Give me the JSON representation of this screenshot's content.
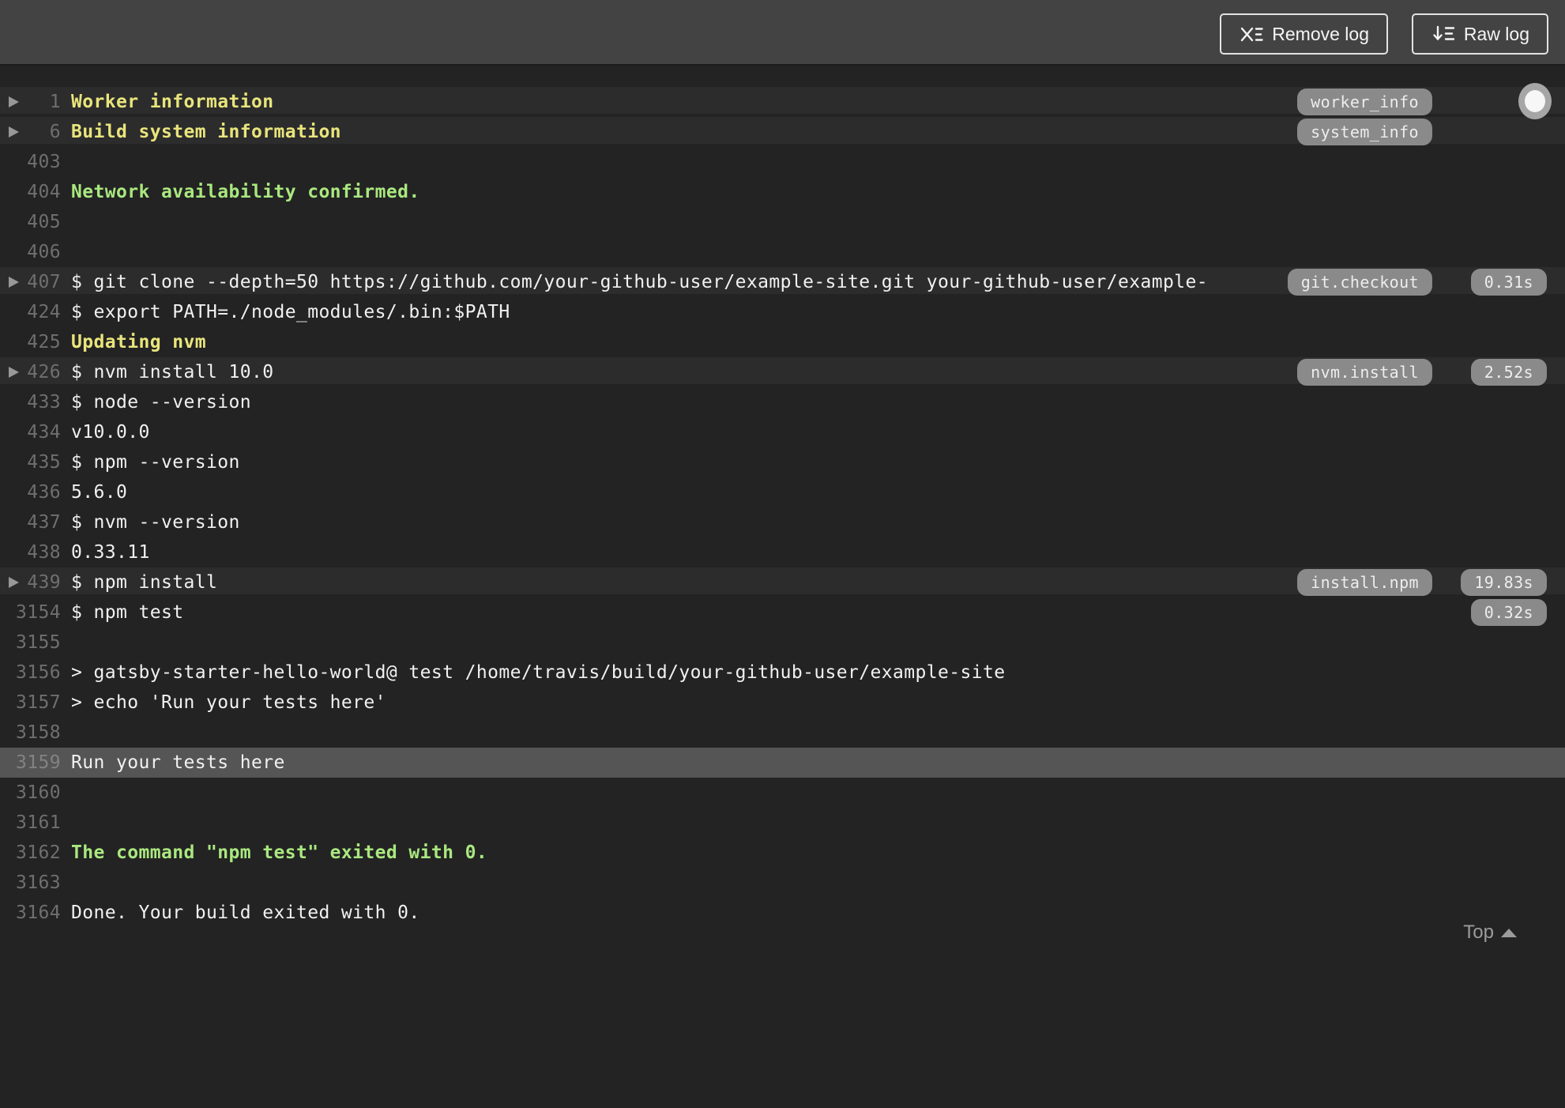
{
  "toolbar": {
    "remove_log_label": "Remove log",
    "raw_log_label": "Raw log"
  },
  "log": {
    "rows": [
      {
        "num": "1",
        "text": "Worker information",
        "style": "yellow",
        "fold": true,
        "arrow": true,
        "tag": "worker_info"
      },
      {
        "num": "6",
        "text": "Build system information",
        "style": "yellow",
        "fold": true,
        "arrow": true,
        "tag": "system_info"
      },
      {
        "num": "403",
        "text": ""
      },
      {
        "num": "404",
        "text": "Network availability confirmed.",
        "style": "green"
      },
      {
        "num": "405",
        "text": ""
      },
      {
        "num": "406",
        "text": ""
      },
      {
        "num": "407",
        "text": "$ git clone --depth=50 https://github.com/your-github-user/example-site.git your-github-user/example-",
        "fold": true,
        "arrow": true,
        "tag": "git.checkout",
        "duration": "0.31s"
      },
      {
        "num": "424",
        "text": "$ export PATH=./node_modules/.bin:$PATH"
      },
      {
        "num": "425",
        "text": "Updating nvm",
        "style": "yellow"
      },
      {
        "num": "426",
        "text": "$ nvm install 10.0",
        "fold": true,
        "arrow": true,
        "tag": "nvm.install",
        "duration": "2.52s"
      },
      {
        "num": "433",
        "text": "$ node --version"
      },
      {
        "num": "434",
        "text": "v10.0.0"
      },
      {
        "num": "435",
        "text": "$ npm --version"
      },
      {
        "num": "436",
        "text": "5.6.0"
      },
      {
        "num": "437",
        "text": "$ nvm --version"
      },
      {
        "num": "438",
        "text": "0.33.11"
      },
      {
        "num": "439",
        "text": "$ npm install",
        "fold": true,
        "arrow": true,
        "tag": "install.npm",
        "duration": "19.83s"
      },
      {
        "num": "3154",
        "text": "$ npm test",
        "duration": "0.32s"
      },
      {
        "num": "3155",
        "text": ""
      },
      {
        "num": "3156",
        "text": "> gatsby-starter-hello-world@ test /home/travis/build/your-github-user/example-site"
      },
      {
        "num": "3157",
        "text": "> echo 'Run your tests here'"
      },
      {
        "num": "3158",
        "text": ""
      },
      {
        "num": "3159",
        "text": "Run your tests here",
        "selected": true
      },
      {
        "num": "3160",
        "text": ""
      },
      {
        "num": "3161",
        "text": ""
      },
      {
        "num": "3162",
        "text": "The command \"npm test\" exited with 0.",
        "style": "green"
      },
      {
        "num": "3163",
        "text": ""
      },
      {
        "num": "3164",
        "text": "Done. Your build exited with 0."
      }
    ]
  },
  "footer": {
    "top_label": "Top"
  },
  "colors": {
    "topbar-bg": "#434343",
    "log-bg": "#232323",
    "fold-bg": "#2c2c2c",
    "selected-bg": "#555555",
    "badge-bg": "#8a8a8a",
    "yellow": "#e9e57c",
    "green": "#aae87f",
    "text": "#f1f1f1",
    "line-number": "#6f6f6f"
  }
}
